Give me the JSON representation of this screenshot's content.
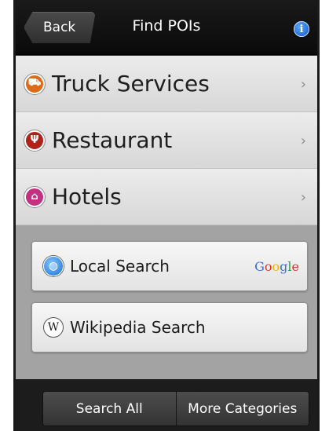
{
  "header": {
    "back_label": "Back",
    "title": "Find POIs",
    "info_glyph": "i"
  },
  "categories": [
    {
      "label": "Truck Services",
      "icon": "truck-icon",
      "color": "#e06a1b",
      "glyph": "⛟"
    },
    {
      "label": "Restaurant",
      "icon": "cutlery-icon",
      "color": "#b0211a",
      "glyph": "Ψ"
    },
    {
      "label": "Hotels",
      "icon": "hotel-icon",
      "color": "#c2327f",
      "glyph": "⌂"
    }
  ],
  "chevron_glyph": "›",
  "search": {
    "local_label": "Local Search",
    "wiki_label": "Wikipedia Search",
    "wiki_glyph": "W",
    "google": [
      "G",
      "o",
      "o",
      "g",
      "l",
      "e"
    ],
    "google_colors": [
      "#3c6fd8",
      "#d8331f",
      "#f0b400",
      "#3c6fd8",
      "#2f9a3a",
      "#d8331f"
    ]
  },
  "bottom": {
    "search_all_label": "Search All",
    "more_label": "More Categories"
  }
}
